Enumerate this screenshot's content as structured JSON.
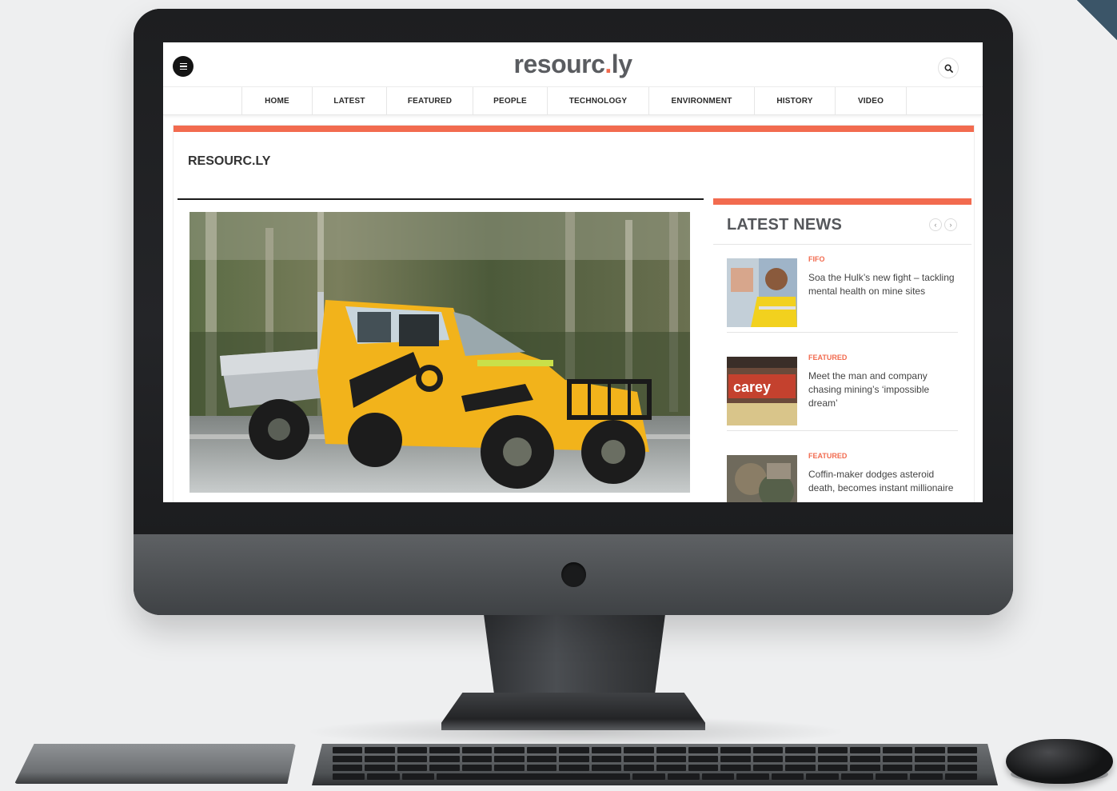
{
  "site": {
    "logo_main": "resourc",
    "logo_dot": ".",
    "logo_end": "ly",
    "page_heading": "RESOURC.LY"
  },
  "nav": {
    "items": [
      {
        "label": "HOME"
      },
      {
        "label": "LATEST"
      },
      {
        "label": "FEATURED"
      },
      {
        "label": "PEOPLE"
      },
      {
        "label": "TECHNOLOGY"
      },
      {
        "label": "ENVIRONMENT"
      },
      {
        "label": "HISTORY"
      },
      {
        "label": "VIDEO"
      }
    ]
  },
  "sidebar": {
    "title": "LATEST NEWS",
    "prev_label": "‹",
    "next_label": "›",
    "items": [
      {
        "category": "FIFO",
        "title": "Soa the Hulk’s new fight – tackling mental health on mine sites"
      },
      {
        "category": "FEATURED",
        "title": "Meet the man and company chasing mining’s ‘impossible dream’",
        "thumb_text": "carey"
      },
      {
        "category": "FEATURED",
        "title": "Coffin-maker dodges asteroid death, becomes instant millionaire"
      }
    ]
  },
  "colors": {
    "accent": "#f26b4f",
    "logo_grey": "#5a5c60",
    "vehicle_yellow": "#f2b31b"
  },
  "icons": {
    "menu": "hamburger-icon",
    "search": "search-icon",
    "prev": "chevron-left-icon",
    "next": "chevron-right-icon",
    "camera": "camera-icon"
  }
}
